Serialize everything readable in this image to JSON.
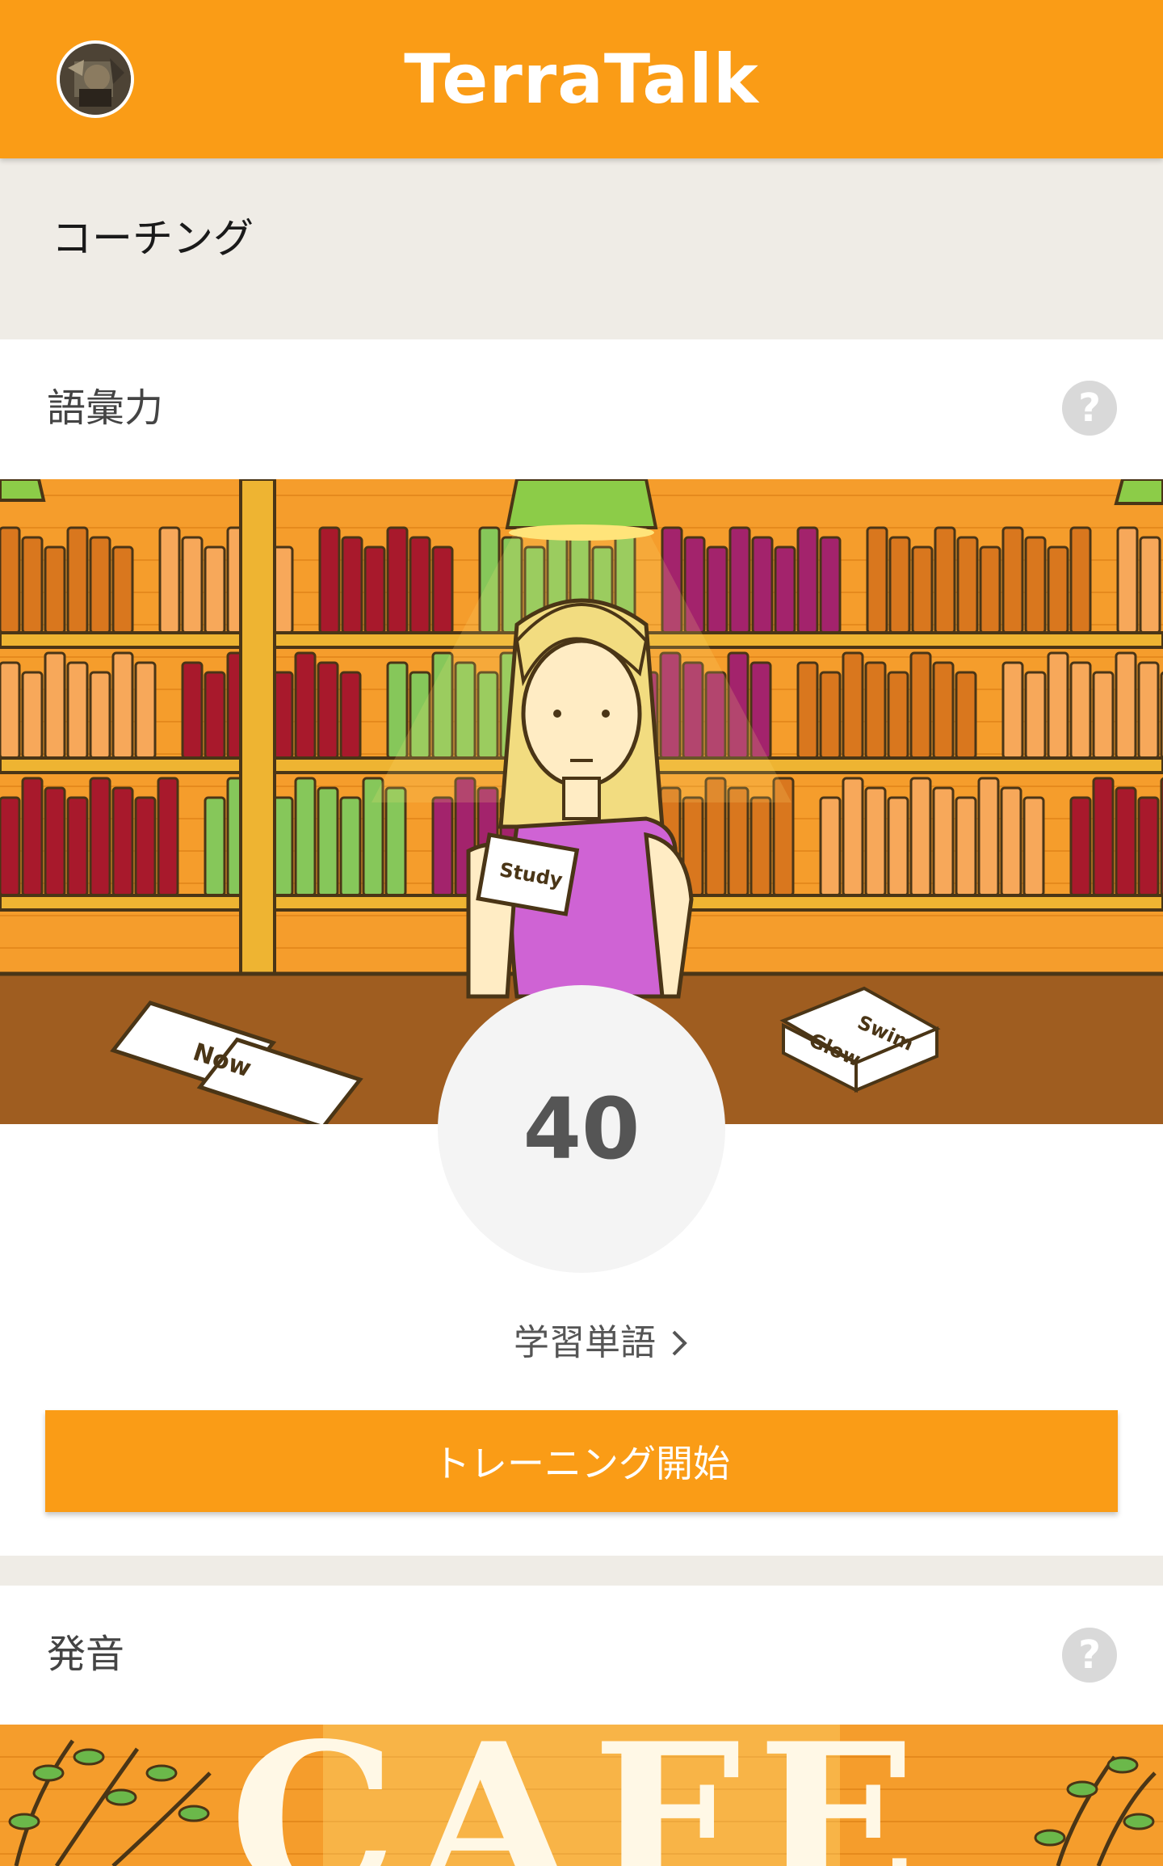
{
  "header": {
    "app_title": "TerraTalk",
    "colors": {
      "brand": "#fa9c16",
      "text": "#ffffff"
    }
  },
  "section": {
    "title": "コーチング"
  },
  "vocab_card": {
    "title": "語彙力",
    "help_icon": "question-mark",
    "illustration": {
      "cards": [
        "Study",
        "Now",
        "Swim",
        "Glow"
      ]
    },
    "score": "40",
    "learned_words_label": "学習単語",
    "start_button_label": "トレーニング開始"
  },
  "pronunciation_card": {
    "title": "発音",
    "help_icon": "question-mark",
    "illustration": {
      "sign": "CAFE"
    }
  }
}
